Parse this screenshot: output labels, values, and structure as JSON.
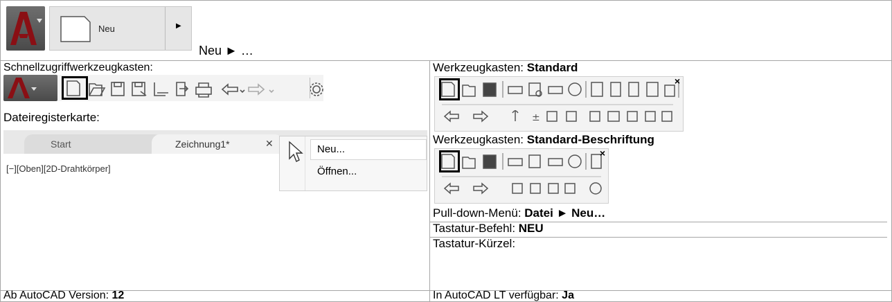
{
  "row1": {
    "ribbon_button_label": "Neu",
    "path_text": "Neu ► …"
  },
  "left": {
    "qat_title": "Schnellzugriffwerkzeugkasten:",
    "filetab_title": "Dateiregisterkarte:",
    "tab_start": "Start",
    "tab_drawing": "Zeichnung1*",
    "tab_close": "✕",
    "menu_new": "Neu...",
    "menu_open": "Öffnen...",
    "viewport_label": "[−][Oben][2D-Drahtkörper]"
  },
  "right": {
    "toolbar1_prefix": "Werkzeugkasten: ",
    "toolbar1_name": "Standard",
    "toolbar2_prefix": "Werkzeugkasten: ",
    "toolbar2_name": "Standard-Beschriftung",
    "pulldown_prefix": "Pull-down-Menü: ",
    "pulldown_value": "Datei ► Neu…",
    "command_prefix": "Tastatur-Befehl: ",
    "command_value": "NEU",
    "shortcut_prefix": "Tastatur-Kürzel:",
    "close_glyph": "×"
  },
  "footer": {
    "version_prefix": "Ab AutoCAD Version: ",
    "version_value": "12",
    "lt_prefix": "In AutoCAD LT verfügbar: ",
    "lt_value": "Ja"
  },
  "icons": {
    "new": "new-document-icon",
    "open": "open-folder-icon",
    "save": "save-icon",
    "saveas": "save-as-icon",
    "print": "print-icon",
    "undo": "undo-icon",
    "redo": "redo-icon",
    "settings": "gear-icon",
    "help": "help-icon"
  }
}
